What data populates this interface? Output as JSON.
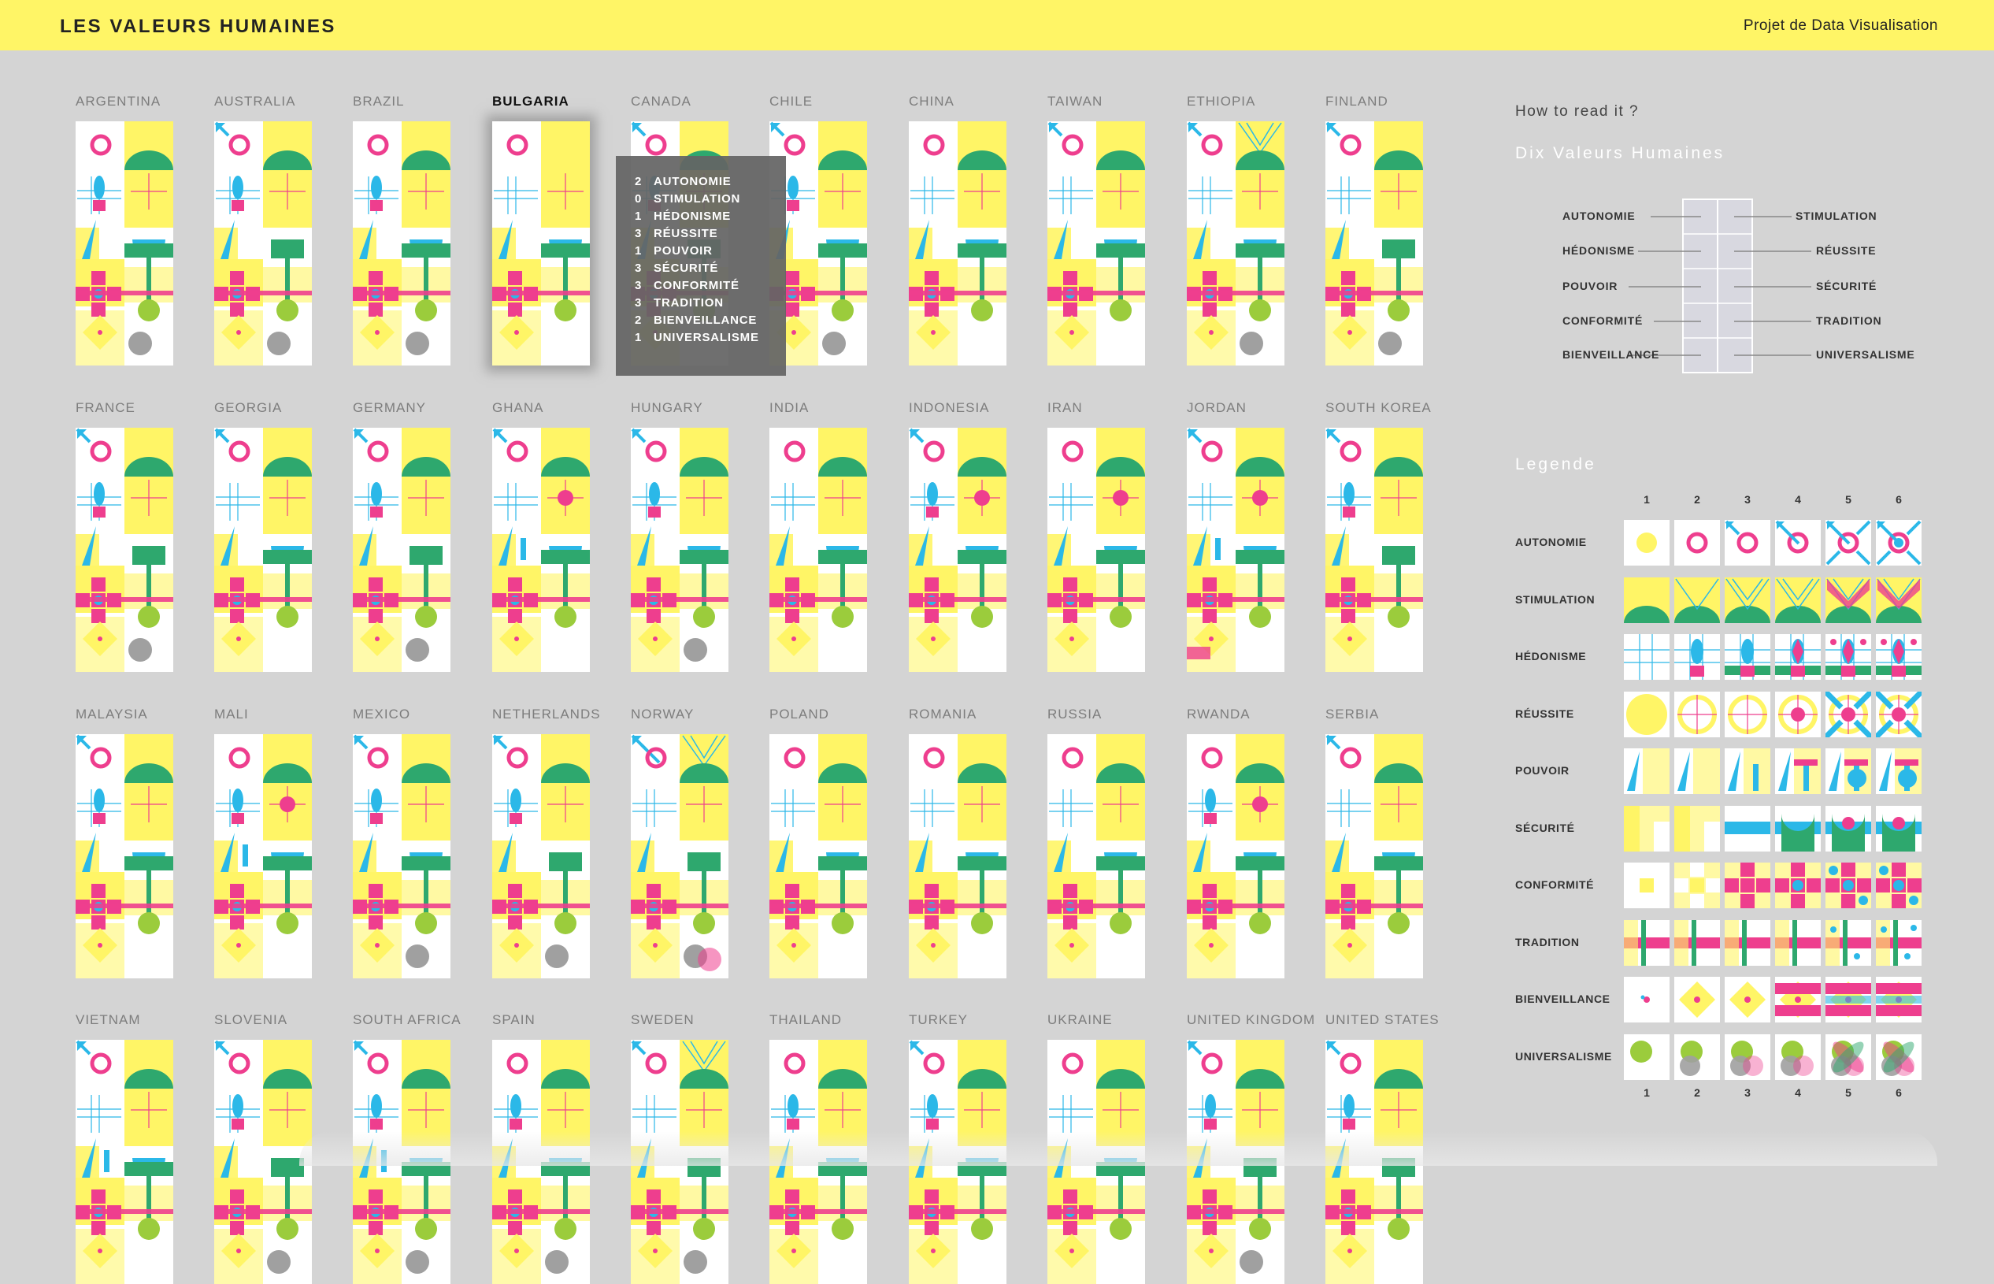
{
  "header": {
    "title": "LES VALEURS HUMAINES",
    "project_link": "Projet de Data Visualisation"
  },
  "colors": {
    "background": "#d4d4d4",
    "header_bg": "#fff566",
    "yellow": "#fff566",
    "magenta": "#ee3e8e",
    "cyan": "#2bb8e8",
    "green": "#2ea86e",
    "lime": "#9bcc3c",
    "grey": "#a0a0a0"
  },
  "countries": [
    {
      "name": "ARGENTINA",
      "v": [
        2,
        1,
        2,
        3,
        2,
        3,
        3,
        3,
        3,
        2
      ]
    },
    {
      "name": "AUSTRALIA",
      "v": [
        3,
        1,
        2,
        3,
        2,
        2,
        3,
        3,
        3,
        2
      ]
    },
    {
      "name": "BRAZIL",
      "v": [
        2,
        1,
        2,
        3,
        2,
        3,
        3,
        3,
        3,
        2
      ]
    },
    {
      "name": "BULGARIA",
      "v": [
        2,
        0,
        1,
        3,
        1,
        3,
        3,
        3,
        2,
        1
      ]
    },
    {
      "name": "CANADA",
      "v": [
        3,
        1,
        2,
        3,
        2,
        2,
        3,
        3,
        3,
        1
      ]
    },
    {
      "name": "CHILE",
      "v": [
        3,
        1,
        2,
        3,
        2,
        3,
        3,
        3,
        3,
        2
      ]
    },
    {
      "name": "CHINA",
      "v": [
        2,
        1,
        1,
        3,
        2,
        3,
        3,
        3,
        3,
        1
      ]
    },
    {
      "name": "TAIWAN",
      "v": [
        3,
        1,
        1,
        3,
        2,
        3,
        3,
        3,
        3,
        1
      ]
    },
    {
      "name": "ETHIOPIA",
      "v": [
        3,
        2,
        1,
        3,
        2,
        3,
        3,
        3,
        3,
        2
      ]
    },
    {
      "name": "FINLAND",
      "v": [
        3,
        1,
        1,
        2,
        1,
        2,
        3,
        3,
        3,
        2
      ]
    },
    {
      "name": "FRANCE",
      "v": [
        3,
        1,
        2,
        2,
        2,
        2,
        3,
        3,
        3,
        2
      ]
    },
    {
      "name": "GEORGIA",
      "v": [
        3,
        1,
        1,
        3,
        2,
        3,
        3,
        3,
        3,
        1
      ]
    },
    {
      "name": "GERMANY",
      "v": [
        3,
        1,
        2,
        3,
        2,
        2,
        3,
        3,
        3,
        2
      ]
    },
    {
      "name": "GHANA",
      "v": [
        3,
        1,
        1,
        4,
        3,
        3,
        3,
        3,
        3,
        1
      ]
    },
    {
      "name": "HUNGARY",
      "v": [
        3,
        1,
        2,
        3,
        2,
        3,
        3,
        3,
        3,
        2
      ]
    },
    {
      "name": "INDIA",
      "v": [
        2,
        1,
        1,
        3,
        2,
        3,
        3,
        3,
        3,
        1
      ]
    },
    {
      "name": "INDONESIA",
      "v": [
        3,
        1,
        2,
        4,
        2,
        3,
        3,
        3,
        3,
        1
      ]
    },
    {
      "name": "IRAN",
      "v": [
        2,
        1,
        1,
        4,
        2,
        3,
        3,
        3,
        3,
        1
      ]
    },
    {
      "name": "JORDAN",
      "v": [
        3,
        1,
        1,
        4,
        3,
        3,
        3,
        5,
        3,
        1
      ]
    },
    {
      "name": "SOUTH KOREA",
      "v": [
        3,
        1,
        2,
        2,
        2,
        2,
        3,
        3,
        3,
        1
      ]
    },
    {
      "name": "MALAYSIA",
      "v": [
        3,
        1,
        2,
        3,
        2,
        3,
        3,
        3,
        3,
        1
      ]
    },
    {
      "name": "MALI",
      "v": [
        2,
        1,
        2,
        4,
        3,
        3,
        3,
        3,
        3,
        1
      ]
    },
    {
      "name": "MEXICO",
      "v": [
        3,
        1,
        2,
        3,
        2,
        3,
        3,
        3,
        3,
        2
      ]
    },
    {
      "name": "NETHERLANDS",
      "v": [
        3,
        1,
        2,
        2,
        2,
        2,
        3,
        3,
        3,
        2
      ]
    },
    {
      "name": "NORWAY",
      "v": [
        4,
        2,
        1,
        3,
        2,
        2,
        3,
        3,
        3,
        3
      ]
    },
    {
      "name": "POLAND",
      "v": [
        2,
        1,
        1,
        3,
        2,
        3,
        3,
        3,
        3,
        1
      ]
    },
    {
      "name": "ROMANIA",
      "v": [
        2,
        1,
        1,
        3,
        2,
        3,
        3,
        3,
        3,
        1
      ]
    },
    {
      "name": "RUSSIA",
      "v": [
        2,
        1,
        1,
        3,
        2,
        3,
        3,
        3,
        3,
        1
      ]
    },
    {
      "name": "RWANDA",
      "v": [
        2,
        1,
        2,
        4,
        2,
        3,
        3,
        3,
        3,
        1
      ]
    },
    {
      "name": "SERBIA",
      "v": [
        3,
        1,
        1,
        3,
        2,
        3,
        3,
        3,
        3,
        1
      ]
    },
    {
      "name": "VIETNAM",
      "v": [
        3,
        1,
        1,
        3,
        3,
        3,
        3,
        3,
        3,
        1
      ]
    },
    {
      "name": "SLOVENIA",
      "v": [
        3,
        1,
        2,
        3,
        2,
        2,
        3,
        3,
        3,
        2
      ]
    },
    {
      "name": "SOUTH AFRICA",
      "v": [
        3,
        1,
        2,
        3,
        3,
        3,
        3,
        3,
        3,
        2
      ]
    },
    {
      "name": "SPAIN",
      "v": [
        2,
        1,
        2,
        2,
        2,
        3,
        3,
        3,
        3,
        2
      ]
    },
    {
      "name": "SWEDEN",
      "v": [
        3,
        2,
        1,
        3,
        2,
        2,
        3,
        3,
        3,
        2
      ]
    },
    {
      "name": "THAILAND",
      "v": [
        2,
        1,
        2,
        3,
        2,
        3,
        3,
        3,
        3,
        1
      ]
    },
    {
      "name": "TURKEY",
      "v": [
        3,
        1,
        2,
        3,
        2,
        3,
        3,
        3,
        3,
        1
      ]
    },
    {
      "name": "UKRAINE",
      "v": [
        2,
        1,
        1,
        2,
        2,
        3,
        3,
        3,
        3,
        1
      ]
    },
    {
      "name": "UNITED KINGDOM",
      "v": [
        3,
        1,
        2,
        3,
        2,
        2,
        3,
        3,
        3,
        2
      ]
    },
    {
      "name": "UNITED STATES",
      "v": [
        3,
        1,
        2,
        3,
        2,
        2,
        3,
        3,
        3,
        1
      ]
    }
  ],
  "active_country": "BULGARIA",
  "tooltip": {
    "rows": [
      {
        "n": "2",
        "label": "AUTONOMIE"
      },
      {
        "n": "0",
        "label": "STIMULATION"
      },
      {
        "n": "1",
        "label": "HÉDONISME"
      },
      {
        "n": "3",
        "label": "RÉUSSITE"
      },
      {
        "n": "1",
        "label": "POUVOIR"
      },
      {
        "n": "3",
        "label": "SÉCURITÉ"
      },
      {
        "n": "3",
        "label": "CONFORMITÉ"
      },
      {
        "n": "3",
        "label": "TRADITION"
      },
      {
        "n": "2",
        "label": "BIENVEILLANCE"
      },
      {
        "n": "1",
        "label": "UNIVERSALISME"
      }
    ]
  },
  "how_to_read": {
    "title": "How to read it ?",
    "subtitle": "Dix Valeurs Humaines",
    "left_labels": [
      "AUTONOMIE",
      "HÉDONISME",
      "POUVOIR",
      "CONFORMITÉ",
      "BIENVEILLANCE"
    ],
    "right_labels": [
      "STIMULATION",
      "RÉUSSITE",
      "SÉCURITÉ",
      "TRADITION",
      "UNIVERSALISME"
    ]
  },
  "legend": {
    "title": "Legende",
    "levels": [
      "1",
      "2",
      "3",
      "4",
      "5",
      "6"
    ],
    "rows": [
      "AUTONOMIE",
      "STIMULATION",
      "HÉDONISME",
      "RÉUSSITE",
      "POUVOIR",
      "SÉCURITÉ",
      "CONFORMITÉ",
      "TRADITION",
      "BIENVEILLANCE",
      "UNIVERSALISME"
    ]
  }
}
